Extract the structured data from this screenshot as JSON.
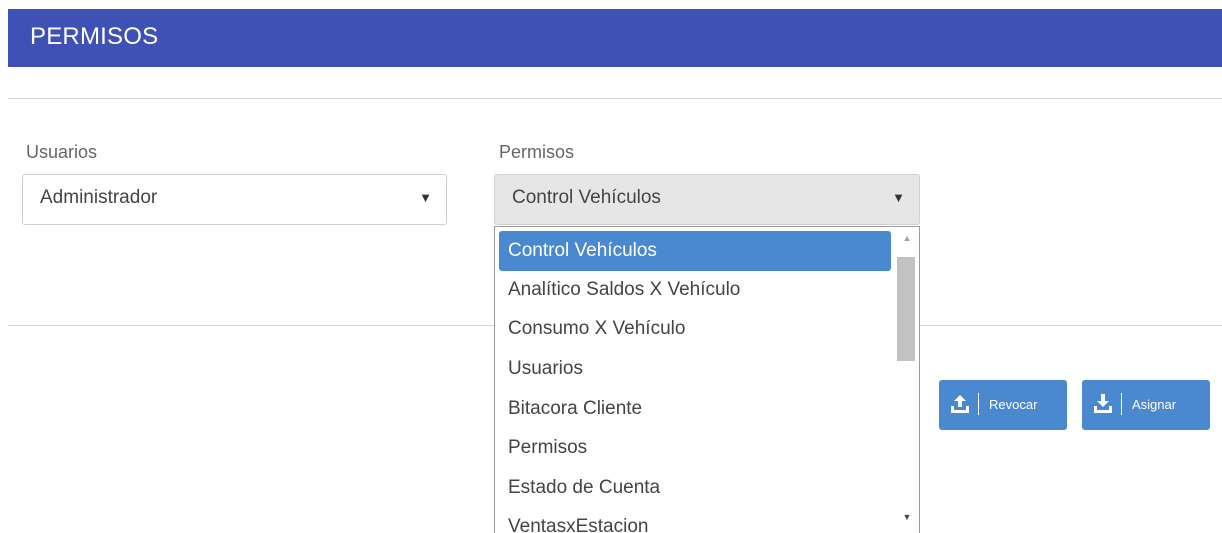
{
  "header": {
    "title": "PERMISOS"
  },
  "usuarios": {
    "label": "Usuarios",
    "selected": "Administrador"
  },
  "permisos": {
    "label": "Permisos",
    "selected": "Control Vehículos",
    "options": [
      "Control Vehículos",
      "Analítico Saldos X Vehículo",
      "Consumo X Vehículo",
      "Usuarios",
      "Bitacora Cliente",
      "Permisos",
      "Estado de Cuenta",
      "VentasxEstacion"
    ]
  },
  "buttons": {
    "revocar": "Revocar",
    "asignar": "Asignar"
  },
  "icons": {
    "caret": "caret-down-icon",
    "upload": "upload-icon",
    "download": "download-icon"
  },
  "colors": {
    "header": "#3f51b5",
    "accent": "#4a89d0"
  }
}
